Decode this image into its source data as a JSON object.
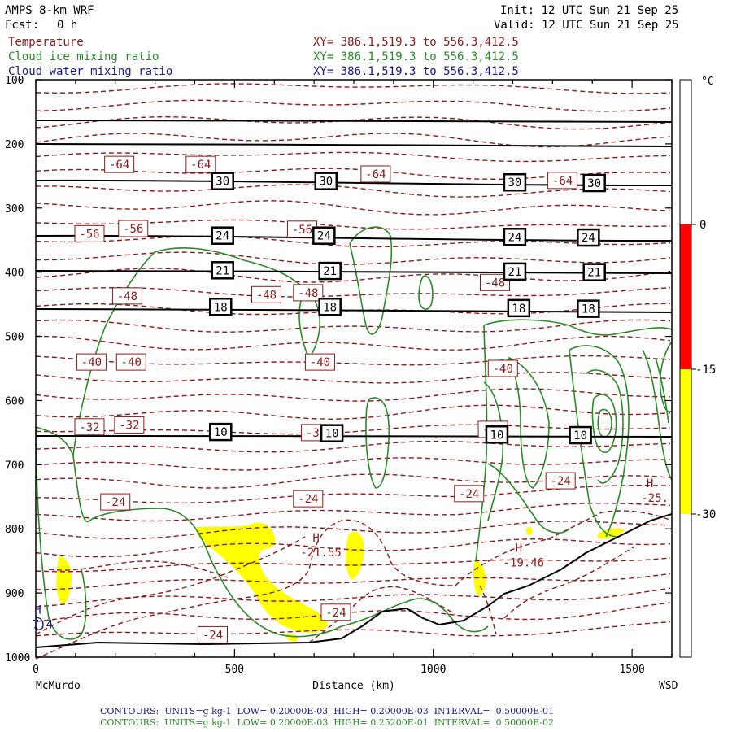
{
  "header": {
    "model": "AMPS 8-km WRF",
    "fcst_label": "Fcst:",
    "fcst_value": "0 h",
    "init": "Init: 12 UTC Sun 21 Sep 25",
    "valid": "Valid: 12 UTC Sun 21 Sep 25"
  },
  "fields": [
    {
      "name": "Temperature",
      "xy": "XY= 386.1,519.3 to 556.3,412.5",
      "color": "#8b1a1a"
    },
    {
      "name": "Cloud ice mixing ratio",
      "xy": "XY= 386.1,519.3 to 556.3,412.5",
      "color": "#2a8a2a"
    },
    {
      "name": "Cloud water mixing ratio",
      "xy": "XY= 386.1,519.3 to 556.3,412.5",
      "color": "#1a1a8b"
    }
  ],
  "footer": [
    {
      "text": "CONTOURS:  UNITS=g kg-1  LOW= 0.20000E-03  HIGH= 0.20000E-03  INTERVAL=  0.50000E-01",
      "color": "#1a1a8b"
    },
    {
      "text": "CONTOURS:  UNITS=g kg-1  LOW= 0.20000E-03  HIGH= 0.25200E-01  INTERVAL=  0.50000E-02",
      "color": "#2a8a2a"
    }
  ],
  "chart_data": {
    "type": "contour cross-section",
    "xlabel": "Distance (km)",
    "x_left_label": "McMurdo",
    "x_right_label": "WSD",
    "ylabel": "",
    "xlim": [
      0,
      1600
    ],
    "ylim": [
      1000,
      100
    ],
    "xticks": [
      0,
      500,
      1000,
      1500
    ],
    "yticks": [
      100,
      200,
      300,
      400,
      500,
      600,
      700,
      800,
      900,
      1000
    ],
    "colors": {
      "temperature": "#8b1a1a",
      "ice": "#2a8a2a",
      "water": "#1a1a8b",
      "potential_temp": "#000000",
      "shading": "#ffff00",
      "hot": "#ff0000"
    },
    "colorbar": {
      "unit": "°C",
      "ticks": [
        "0",
        "-15",
        "-30"
      ],
      "bands": [
        {
          "from": 0,
          "to": -15,
          "color": "#ff0000"
        },
        {
          "from": -15,
          "to": -30,
          "color": "#ffff00"
        }
      ]
    },
    "temperature_labels": [
      {
        "text": "-64",
        "x": 210,
        "p": 232
      },
      {
        "text": "-64",
        "x": 415,
        "p": 232
      },
      {
        "text": "-64",
        "x": 855,
        "p": 247
      },
      {
        "text": "-64",
        "x": 1325,
        "p": 257
      },
      {
        "text": "-56",
        "x": 135,
        "p": 340
      },
      {
        "text": "-56",
        "x": 245,
        "p": 332
      },
      {
        "text": "-56",
        "x": 670,
        "p": 333
      },
      {
        "text": "-48",
        "x": 230,
        "p": 437
      },
      {
        "text": "-48",
        "x": 580,
        "p": 435
      },
      {
        "text": "-48",
        "x": 685,
        "p": 432
      },
      {
        "text": "-48",
        "x": 1155,
        "p": 416
      },
      {
        "text": "-40",
        "x": 140,
        "p": 540
      },
      {
        "text": "-40",
        "x": 240,
        "p": 540
      },
      {
        "text": "-40",
        "x": 715,
        "p": 540
      },
      {
        "text": "-40",
        "x": 1175,
        "p": 550
      },
      {
        "text": "-32",
        "x": 135,
        "p": 641
      },
      {
        "text": "-32",
        "x": 235,
        "p": 638
      },
      {
        "text": "-32",
        "x": 705,
        "p": 650
      },
      {
        "text": "-32",
        "x": 1150,
        "p": 645
      },
      {
        "text": "-24",
        "x": 200,
        "p": 758
      },
      {
        "text": "-24",
        "x": 685,
        "p": 753
      },
      {
        "text": "-24",
        "x": 1090,
        "p": 745
      },
      {
        "text": "-24",
        "x": 1320,
        "p": 725
      },
      {
        "text": "-24",
        "x": 755,
        "p": 930
      },
      {
        "text": "-24",
        "x": 445,
        "p": 965
      }
    ],
    "theta_labels": [
      {
        "text": "30",
        "x": 470,
        "p": 258
      },
      {
        "text": "30",
        "x": 730,
        "p": 258
      },
      {
        "text": "30",
        "x": 1205,
        "p": 260
      },
      {
        "text": "30",
        "x": 1405,
        "p": 261
      },
      {
        "text": "24",
        "x": 470,
        "p": 343
      },
      {
        "text": "24",
        "x": 725,
        "p": 343
      },
      {
        "text": "24",
        "x": 1205,
        "p": 345
      },
      {
        "text": "24",
        "x": 1390,
        "p": 346
      },
      {
        "text": "21",
        "x": 470,
        "p": 397
      },
      {
        "text": "21",
        "x": 740,
        "p": 398
      },
      {
        "text": "21",
        "x": 1205,
        "p": 399
      },
      {
        "text": "21",
        "x": 1405,
        "p": 400
      },
      {
        "text": "18",
        "x": 465,
        "p": 454
      },
      {
        "text": "18",
        "x": 740,
        "p": 454
      },
      {
        "text": "18",
        "x": 1215,
        "p": 456
      },
      {
        "text": "18",
        "x": 1390,
        "p": 457
      },
      {
        "text": "10",
        "x": 465,
        "p": 649
      },
      {
        "text": "10",
        "x": 745,
        "p": 651
      },
      {
        "text": "10",
        "x": 1160,
        "p": 653
      },
      {
        "text": "10",
        "x": 1370,
        "p": 654
      }
    ],
    "high_labels": [
      {
        "text": "H",
        "x": 705,
        "p": 820,
        "value": "-21.55"
      },
      {
        "text": "H",
        "x": 1215,
        "p": 836,
        "value": "-19.46"
      },
      {
        "text": "H",
        "x": 1545,
        "p": 735,
        "value": "-25."
      },
      {
        "text": "H",
        "x": 5,
        "p": 932,
        "value": "7.4"
      }
    ]
  }
}
